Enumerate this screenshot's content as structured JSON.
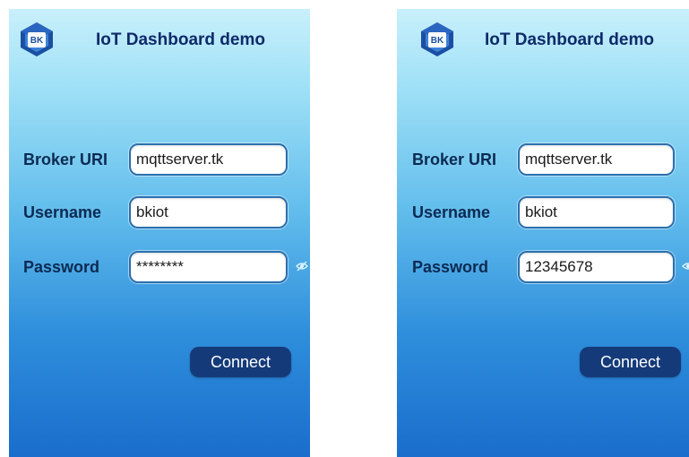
{
  "screens": [
    {
      "app_title": "IoT Dashboard demo",
      "logo_text": "BK",
      "fields": {
        "broker_uri": {
          "label": "Broker URI",
          "value": "mqttserver.tk"
        },
        "username": {
          "label": "Username",
          "value": "bkiot"
        },
        "password": {
          "label": "Password",
          "value": "********"
        }
      },
      "password_visibility_icon": "eye-off-icon",
      "connect_label": "Connect"
    },
    {
      "app_title": "IoT Dashboard demo",
      "logo_text": "BK",
      "fields": {
        "broker_uri": {
          "label": "Broker URI",
          "value": "mqttserver.tk"
        },
        "username": {
          "label": "Username",
          "value": "bkiot"
        },
        "password": {
          "label": "Password",
          "value": "12345678"
        }
      },
      "password_visibility_icon": "eye-icon",
      "connect_label": "Connect"
    }
  ],
  "colors": {
    "gradient_top": "#c9f0fb",
    "gradient_bottom": "#1a6dcc",
    "title": "#0e2a6a",
    "button": "#143a7a",
    "field_border": "#2a6fae"
  }
}
